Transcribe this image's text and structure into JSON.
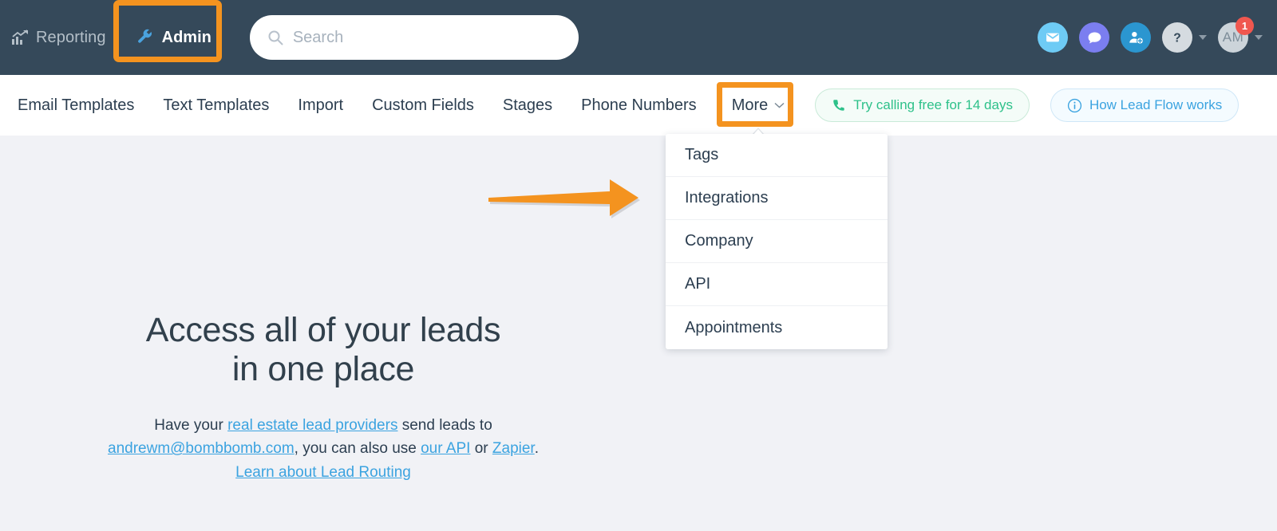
{
  "header": {
    "reporting_label": "Reporting",
    "reporting_icon": "chart-trend-icon",
    "admin_label": "Admin",
    "admin_icon": "wrench-icon",
    "search": {
      "value": "",
      "placeholder": "Search",
      "icon": "search-icon"
    },
    "actions": [
      {
        "name": "mail-icon",
        "color": "#6ecbf5"
      },
      {
        "name": "chat-icon",
        "color": "#7b7ef0"
      },
      {
        "name": "add-user-icon",
        "color": "#2b96d0"
      },
      {
        "name": "help-icon",
        "color": "#d5dbe0"
      }
    ],
    "avatar": {
      "initials": "AM",
      "badge_count": "1",
      "badge_color": "#f0574f"
    }
  },
  "subnav": {
    "items": [
      {
        "label": "Email Templates"
      },
      {
        "label": "Text Templates"
      },
      {
        "label": "Import"
      },
      {
        "label": "Custom Fields"
      },
      {
        "label": "Stages"
      },
      {
        "label": "Phone Numbers"
      }
    ],
    "more_label": "More",
    "pills": [
      {
        "label": "Try calling free for 14 days",
        "icon": "phone-icon",
        "color": "#2ec18a"
      },
      {
        "label": "How Lead Flow works",
        "icon": "info-icon",
        "color": "#3ba3e0"
      }
    ]
  },
  "dropdown": {
    "items": [
      {
        "label": "Tags"
      },
      {
        "label": "Integrations"
      },
      {
        "label": "Company"
      },
      {
        "label": "API"
      },
      {
        "label": "Appointments"
      }
    ]
  },
  "main": {
    "title_line1": "Access all of your leads",
    "title_line2": "in one place",
    "body_1": "Have your ",
    "link_providers": "real estate lead providers",
    "body_2": " send leads to",
    "link_email": "andrewm@bombbomb.com",
    "body_3": ", you can also use ",
    "link_api": "our API",
    "body_4": " or ",
    "link_zapier": "Zapier",
    "body_5": ".",
    "link_learn": "Learn about Lead Routing"
  },
  "annotations": {
    "highlight_color": "#f4931f",
    "highlighted_admin": "Admin",
    "highlighted_more": "More",
    "arrow_points_to": "Integrations"
  }
}
